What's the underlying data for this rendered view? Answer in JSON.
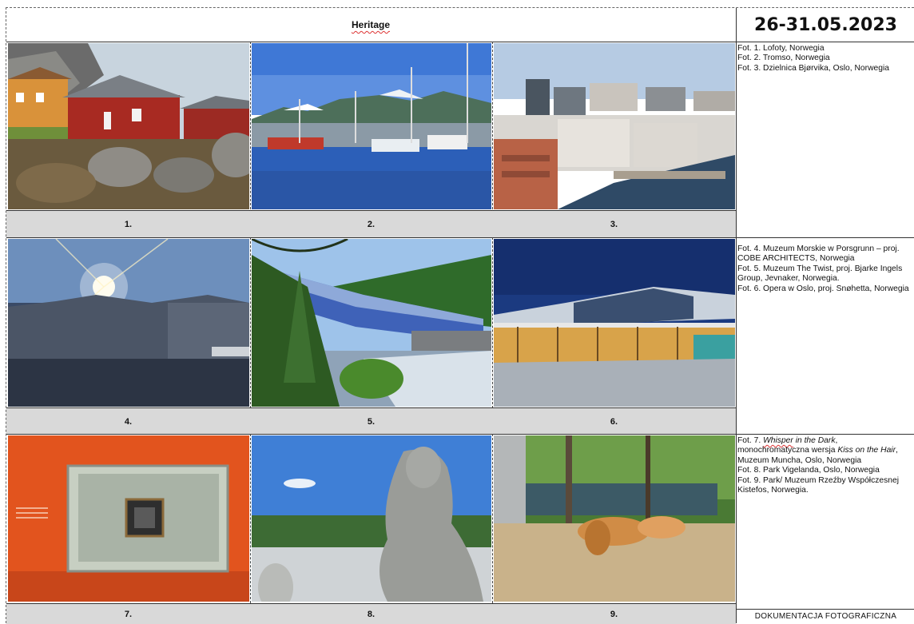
{
  "header": {
    "title": "Heritage",
    "date": "26-31.05.2023"
  },
  "rows": [
    {
      "photos": [
        {
          "number": "1.",
          "subject": "Lofoty red fishing cabins on rocks"
        },
        {
          "number": "2.",
          "subject": "Tromso harbour with boats"
        },
        {
          "number": "3.",
          "subject": "Bjørvika district aerial"
        }
      ],
      "notes": [
        "Fot. 1. Lofoty, Norwegia",
        "Fot. 2. Tromso, Norwegia",
        "Fot. 3. Dzielnica Bjørvika, Oslo, Norwegia"
      ]
    },
    {
      "photos": [
        {
          "number": "4.",
          "subject": "Maritime museum against sun"
        },
        {
          "number": "5.",
          "subject": "The Twist bridge museum"
        },
        {
          "number": "6.",
          "subject": "Oslo Opera at dusk"
        }
      ],
      "notes": [
        "Fot. 4. Muzeum Morskie w Porsgrunn – proj. COBE ARCHITECTS, Norwegia",
        "Fot. 5. Muzeum The Twist, proj. Bjarke Ingels Group, Jevnaker, Norwegia.",
        " Fot. 6. Opera w Oslo, proj. Snøhetta, Norwegia"
      ]
    },
    {
      "photos": [
        {
          "number": "7.",
          "subject": "Framed artwork on orange wall"
        },
        {
          "number": "8.",
          "subject": "Vigeland park sculpture"
        },
        {
          "number": "9.",
          "subject": "Golden sculpture in forest park"
        }
      ],
      "notes_rich": {
        "line1_prefix": "Fot. 7. ",
        "line1_italic": "Whisper",
        "line1_mid": " in the Dark",
        "line1_suffix": ",",
        "line2_prefix": "monochromatyczna wersja ",
        "line2_italic": "Kiss on the Hair",
        "line2_suffix": ", Muzeum Muncha, Oslo, Norwegia",
        "line3": "Fot. 8. Park Vigelanda, Oslo, Norwegia",
        "line4": "Fot. 9. Park/ Muzeum Rzeźby Współczesnej Kistefos, Norwegia."
      }
    }
  ],
  "footer": {
    "label": "DOKUMENTACJA FOTOGRAFICZNA"
  }
}
